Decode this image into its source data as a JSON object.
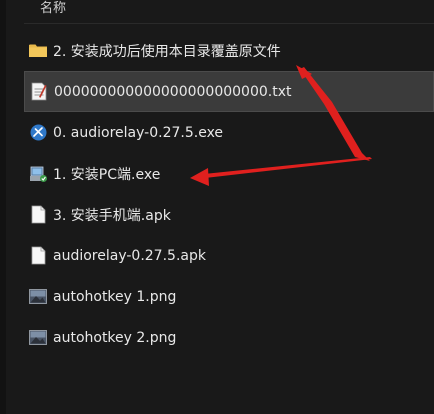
{
  "header": {
    "name_column": "名称"
  },
  "files": [
    {
      "label": "2. 安装成功后使用本目录覆盖原文件",
      "icon": "folder-icon",
      "selected": false
    },
    {
      "label": "000000000000000000000000.txt",
      "icon": "text-file-icon",
      "selected": true
    },
    {
      "label": "0. audiorelay-0.27.5.exe",
      "icon": "audiorelay-app-icon",
      "selected": false
    },
    {
      "label": "1. 安装PC端.exe",
      "icon": "installer-exe-icon",
      "selected": false
    },
    {
      "label": "3. 安装手机端.apk",
      "icon": "blank-file-icon",
      "selected": false
    },
    {
      "label": "audiorelay-0.27.5.apk",
      "icon": "blank-file-icon",
      "selected": false
    },
    {
      "label": "autohotkey 1.png",
      "icon": "image-file-icon",
      "selected": false
    },
    {
      "label": "autohotkey 2.png",
      "icon": "image-file-icon",
      "selected": false
    }
  ],
  "colors": {
    "background": "#191919",
    "selection": "#3b3b3b",
    "folder": "#e8b84a",
    "annotation_arrow": "#e0201e"
  }
}
